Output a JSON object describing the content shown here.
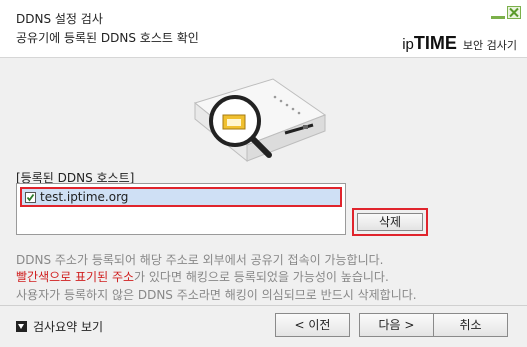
{
  "header": {
    "title": "DDNS 설정 검사",
    "subtitle": "공유기에 등록된 DDNS 호스트 확인",
    "brand_logo_ip": "ip",
    "brand_logo_time": "TIME",
    "brand_sub": "보안 검사기"
  },
  "list": {
    "label": "[등록된 DDNS 호스트]",
    "items": [
      {
        "host": "test.iptime.org",
        "checked": true
      }
    ]
  },
  "buttons": {
    "delete": "삭제",
    "prev": "< 이전",
    "next": "다음 >",
    "cancel": "취소"
  },
  "description": {
    "line1": "DDNS 주소가 등록되어 해당 주소로 외부에서 공유기 접속이 가능합니다.",
    "line2_red": "빨간색으로 표기된 주소",
    "line2_rest": "가 있다면 해킹으로 등록되었을 가능성이 높습니다.",
    "line3": "사용자가 등록하지 않은 DDNS 주소라면 해킹이 의심되므로 반드시 삭제합니다."
  },
  "footer": {
    "summary_toggle": "검사요약 보기"
  },
  "colors": {
    "highlight_border": "#e0242c",
    "selected_row": "#cfe0f5",
    "warning_text": "#d02020",
    "brand_green": "#7bb04a"
  },
  "icons": {
    "window_minimize": "minimize-icon",
    "window_close": "close-icon",
    "router_illustration": "router-magnifier-icon",
    "summary_toggle": "triangle-down-icon"
  }
}
